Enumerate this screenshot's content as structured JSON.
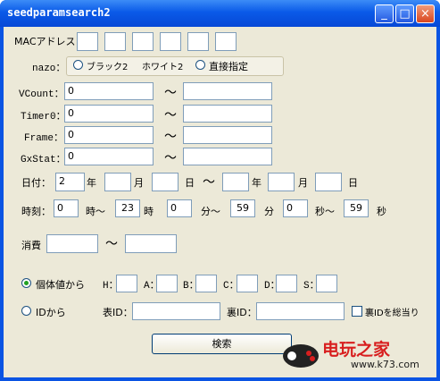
{
  "window": {
    "title": "seedparamsearch2"
  },
  "title_buttons": {
    "minimize": "_",
    "maximize": "□",
    "close": "×"
  },
  "mac": {
    "label": "MACアドレス",
    "values": [
      "",
      "",
      "",
      "",
      "",
      ""
    ]
  },
  "nazo": {
    "label": "nazo：",
    "options": [
      "ブラック2",
      "ホワイト2",
      "直接指定"
    ],
    "selected": "none"
  },
  "range_rows": [
    {
      "label": "VCount：",
      "from": "0",
      "to": ""
    },
    {
      "label": "Timer0：",
      "from": "0",
      "to": ""
    },
    {
      "label": "Frame：",
      "from": "0",
      "to": ""
    },
    {
      "label": "GxStat：",
      "from": "0",
      "to": ""
    }
  ],
  "tilde": "～",
  "date": {
    "label": "日付：",
    "from": {
      "year": "2",
      "month": "",
      "day": ""
    },
    "to": {
      "year": "",
      "month": "",
      "day": ""
    },
    "year_label": "年",
    "month_label": "月",
    "day_label": "日"
  },
  "time": {
    "label": "時刻：",
    "hour_from": "0",
    "hour_to": "23",
    "minute_from": "0",
    "minute_to": "59",
    "second_from": "0",
    "second_to": "59",
    "hour_tilde_label": "時～",
    "hour_label": "時",
    "minute_tilde_label": "分～",
    "minute_label": "分",
    "second_tilde_label": "秒～",
    "second_label": "秒"
  },
  "consume": {
    "label": "消費",
    "from": "",
    "to": ""
  },
  "iv": {
    "mode_label": "個体値から",
    "selected": true,
    "stats": [
      {
        "label": "H：",
        "value": ""
      },
      {
        "label": "A：",
        "value": ""
      },
      {
        "label": "B：",
        "value": ""
      },
      {
        "label": "C：",
        "value": ""
      },
      {
        "label": "D：",
        "value": ""
      },
      {
        "label": "S：",
        "value": ""
      }
    ]
  },
  "id_mode": {
    "mode_label": "IDから",
    "selected": false,
    "tid_label": "表ID：",
    "tid_value": "",
    "sid_label": "裏ID：",
    "sid_value": "",
    "brute_label": "裏IDを総当り",
    "brute_checked": false
  },
  "search_button": "検索",
  "watermark": {
    "brand": "电玩之家",
    "url": "www.k73.com"
  },
  "colors": {
    "title_bar": "#0a54e3",
    "client_bg": "#ece9d8",
    "field_border": "#7f9db9",
    "watermark_red": "#d81e1e"
  }
}
